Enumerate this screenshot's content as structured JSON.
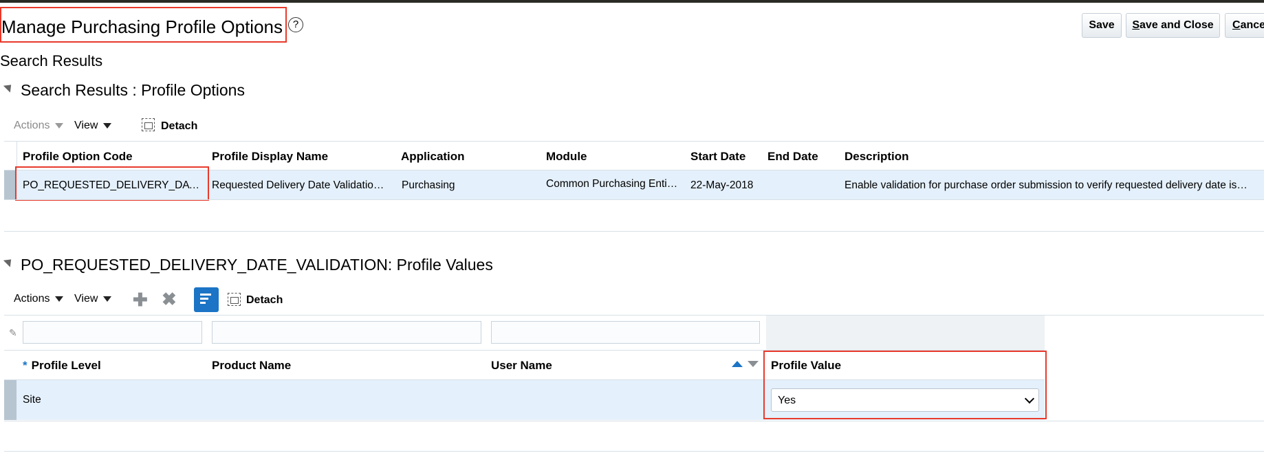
{
  "page": {
    "title": "Manage Purchasing Profile Options",
    "help_glyph": "?",
    "subtitle": "Search Results"
  },
  "header_buttons": {
    "save": "Save",
    "save_close_mnemonic": "S",
    "save_close_rest": "ave and Close",
    "cancel_mnemonic": "C",
    "cancel_rest": "ance"
  },
  "search_section": {
    "title": "Search Results : Profile Options",
    "toolbar": {
      "actions": "Actions",
      "view": "View",
      "detach": "Detach"
    },
    "columns": [
      "Profile Option Code",
      "Profile Display Name",
      "Application",
      "Module",
      "Start Date",
      "End Date",
      "Description"
    ],
    "row": {
      "code": "PO_REQUESTED_DELIVERY_DAT…",
      "display_name": "Requested Delivery Date Validatio…",
      "application": "Purchasing",
      "module": "Common Purchasing Enti…",
      "start_date": "22-May-2018",
      "end_date": "",
      "description": "Enable validation for purchase order submission to verify requested delivery date is…"
    }
  },
  "values_section": {
    "title": "PO_REQUESTED_DELIVERY_DATE_VALIDATION: Profile Values",
    "toolbar": {
      "actions": "Actions",
      "view": "View",
      "detach": "Detach"
    },
    "required_marker": "*",
    "columns": [
      "Profile Level",
      "Product Name",
      "User Name",
      "Profile Value"
    ],
    "row": {
      "profile_level": "Site",
      "product_name": "",
      "user_name": "",
      "profile_value": "Yes"
    }
  },
  "colors": {
    "highlight_border": "#e8392b",
    "selected_row": "#e4f0fb",
    "accent_blue": "#1b74c5"
  }
}
